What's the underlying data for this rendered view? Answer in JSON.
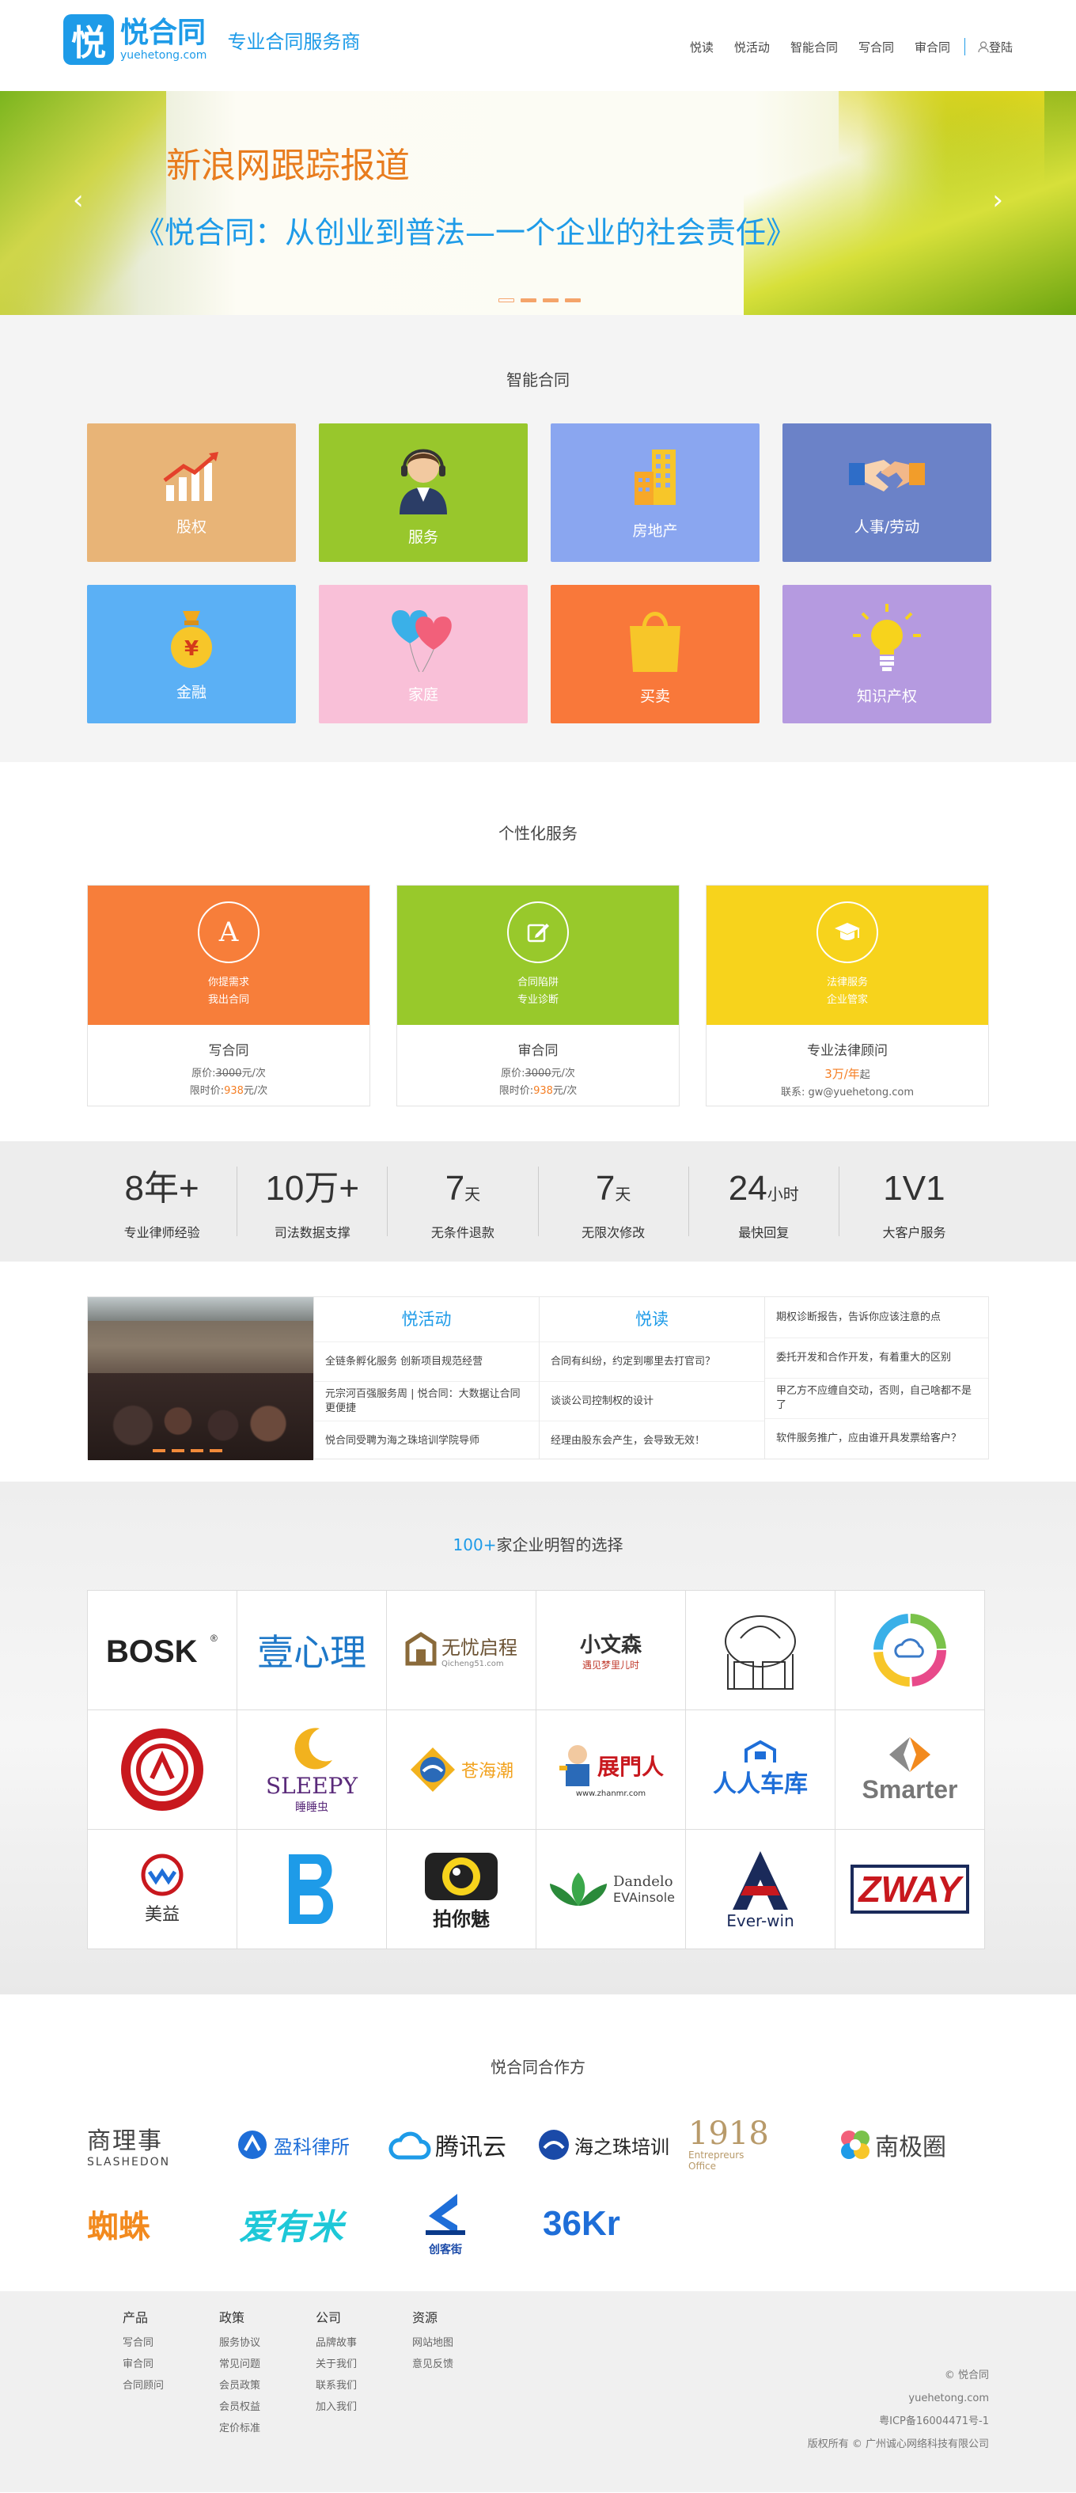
{
  "header": {
    "logo_char": "悦",
    "logo_name": "悦合同",
    "logo_url": "yuehetong.com",
    "slogan": "专业合同服务商",
    "nav": [
      "悦读",
      "悦活动",
      "智能合同",
      "写合同",
      "审合同"
    ],
    "login": "登陆"
  },
  "banner": {
    "headline": "新浪网跟踪报道",
    "subline": "《悦合同：从创业到普法—一个企业的社会责任》",
    "prev": "‹",
    "next": "›"
  },
  "smart": {
    "title": "智能合同",
    "tiles": [
      {
        "label": "股权",
        "icon": "chart-growth-icon",
        "color": "#e8b477"
      },
      {
        "label": "服务",
        "icon": "customer-service-icon",
        "color": "#98c72c"
      },
      {
        "label": "房地产",
        "icon": "building-icon",
        "color": "#8aa6f0"
      },
      {
        "label": "人事/劳动",
        "icon": "handshake-icon",
        "color": "#6b82c8"
      },
      {
        "label": "金融",
        "icon": "money-bag-icon",
        "color": "#5bb0f5"
      },
      {
        "label": "家庭",
        "icon": "heart-balloons-icon",
        "color": "#f9c0d8"
      },
      {
        "label": "买卖",
        "icon": "shopping-bag-icon",
        "color": "#f9783a"
      },
      {
        "label": "知识产权",
        "icon": "lightbulb-icon",
        "color": "#b59ae0"
      }
    ]
  },
  "personal": {
    "title": "个性化服务",
    "cards": [
      {
        "badge": "A",
        "tag1": "你提需求",
        "tag2": "我出合同",
        "title": "写合同",
        "orig_label": "原价:",
        "orig_price": "3000",
        "unit": "元/次",
        "sale_label": "限时价:",
        "sale_price": "938",
        "color": "#f77e3a",
        "icon": "letter-a-icon"
      },
      {
        "badge": "",
        "tag1": "合同陷阱",
        "tag2": "专业诊断",
        "title": "审合同",
        "orig_label": "原价:",
        "orig_price": "3000",
        "unit": "元/次",
        "sale_label": "限时价:",
        "sale_price": "938",
        "color": "#98c92b",
        "icon": "edit-icon"
      },
      {
        "badge": "",
        "tag1": "法律服务",
        "tag2": "企业管家",
        "title": "专业法律顾问",
        "price": "3万/年",
        "price_suffix": "起",
        "contact": "联系: gw@yuehetong.com",
        "color": "#f7d31c",
        "icon": "graduation-cap-icon"
      }
    ]
  },
  "stats": [
    {
      "num": "8年+",
      "unit": "",
      "label": "专业律师经验"
    },
    {
      "num": "10万+",
      "unit": "",
      "label": "司法数据支撑"
    },
    {
      "num": "7",
      "unit": "天",
      "label": "无条件退款"
    },
    {
      "num": "7",
      "unit": "天",
      "label": "无限次修改"
    },
    {
      "num": "24",
      "unit": "小时",
      "label": "最快回复"
    },
    {
      "num": "1V1",
      "unit": "",
      "label": "大客户服务"
    }
  ],
  "news": {
    "activity_title": "悦活动",
    "activity": [
      "全链条孵化服务 创新项目规范经营",
      "元宗河百强服务周 | 悦合同：大数据让合同更便捷",
      "悦合同受聘为海之珠培训学院导师"
    ],
    "read_title": "悦读",
    "read": [
      "合同有纠纷，约定到哪里去打官司？",
      "谈谈公司控制权的设计",
      "经理由股东会产生，会导致无效！"
    ],
    "more": [
      "期权诊断报告，告诉你应该注意的点",
      "委托开发和合作开发，有着重大的区别",
      "甲乙方不应缠自交动，否则，自己啥都不是了",
      "软件服务推广，应由谁开具发票给客户？"
    ]
  },
  "clients": {
    "count": "100+",
    "title_rest": "家企业明智的选择",
    "logos": [
      {
        "text": "BOSK",
        "icon": "bosk-logo"
      },
      {
        "text": "壹心理",
        "icon": "yixinli-logo"
      },
      {
        "text": "无忧启程",
        "sub": "Qicheng51.com",
        "icon": "wuyou-logo"
      },
      {
        "text": "小文森",
        "sub": "遇见梦里儿时",
        "icon": "xiaowensen-logo"
      },
      {
        "text": "",
        "icon": "sketch-house-logo"
      },
      {
        "text": "",
        "icon": "cloud-ring-logo"
      },
      {
        "text": "",
        "icon": "red-seal-logo"
      },
      {
        "text": "SLEEPY",
        "sub": "睡睡虫",
        "icon": "sleepy-logo"
      },
      {
        "text": "苍海潮",
        "icon": "canghaichao-logo"
      },
      {
        "text": "展門人",
        "sub": "www.zhanmr.com",
        "icon": "zhanmenren-logo"
      },
      {
        "text": "人人车库",
        "icon": "renrenchekou-logo"
      },
      {
        "text": "Smarter",
        "icon": "smarter-logo"
      },
      {
        "text": "美益",
        "icon": "meiyi-logo"
      },
      {
        "text": "",
        "icon": "b-logo"
      },
      {
        "text": "拍你魅",
        "icon": "camera-logo"
      },
      {
        "text": "Dandelo",
        "sub": "EVAinsole",
        "icon": "dandelo-logo"
      },
      {
        "text": "Ever-win",
        "icon": "everwin-logo"
      },
      {
        "text": "ZWAY",
        "icon": "zway-logo"
      }
    ]
  },
  "partners": {
    "title": "悦合同合作方",
    "row1": [
      {
        "text": "商理事",
        "sub": "SLASHEDON",
        "icon": "slashedon-logo"
      },
      {
        "text": "盈科律所",
        "icon": "yingke-logo"
      },
      {
        "text": "腾讯云",
        "icon": "tencent-cloud-logo"
      },
      {
        "text": "海之珠培训",
        "icon": "haizhizhu-logo"
      },
      {
        "text": "1918",
        "sub": "Entrepreurs Office",
        "icon": "1918-logo"
      },
      {
        "text": "南极圈",
        "icon": "nanjiquan-logo"
      }
    ],
    "row2": [
      {
        "text": "蜘蛛",
        "icon": "zhizhu-logo"
      },
      {
        "text": "爱有米",
        "icon": "aiyoumi-logo"
      },
      {
        "text": "创客街",
        "icon": "chuangkejie-logo"
      },
      {
        "text": "36Kr",
        "icon": "36kr-logo"
      }
    ]
  },
  "footer": {
    "cols": [
      {
        "h": "产品",
        "items": [
          "写合同",
          "审合同",
          "合同顾问"
        ]
      },
      {
        "h": "政策",
        "items": [
          "服务协议",
          "常见问题",
          "会员政策",
          "会员权益",
          "定价标准"
        ]
      },
      {
        "h": "公司",
        "items": [
          "品牌故事",
          "关于我们",
          "联系我们",
          "加入我们"
        ]
      },
      {
        "h": "资源",
        "items": [
          "网站地图",
          "意见反馈"
        ]
      }
    ],
    "right": [
      "© 悦合同",
      "yuehetong.com",
      "粤ICP备16004471号-1",
      "版权所有 © 广州诚心网络科技有限公司"
    ]
  }
}
